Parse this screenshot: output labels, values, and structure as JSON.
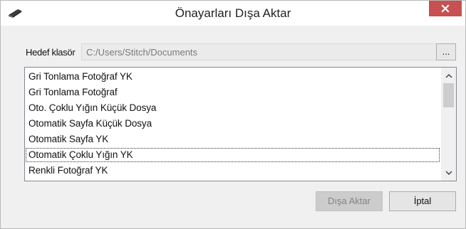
{
  "window": {
    "title": "Önayarları Dışa Aktar",
    "icon": "scanner-icon",
    "close_icon": "close-icon",
    "close_color": "#c75050"
  },
  "destination": {
    "label": "Hedef klasör",
    "value": "C:/Users/Stitch/Documents",
    "browse_label": "..."
  },
  "presets": {
    "items": [
      "Gri Tonlama Fotoğraf YK",
      "Gri Tonlama Fotoğraf",
      "Oto. Çoklu Yığın Küçük Dosya",
      "Otomatik Sayfa Küçük Dosya",
      "Otomatik Sayfa YK",
      "Otomatik Çoklu Yığın YK",
      "Renkli Fotoğraf YK"
    ],
    "focused_index": 5
  },
  "buttons": {
    "export_label": "Dışa Aktar",
    "cancel_label": "İptal"
  }
}
